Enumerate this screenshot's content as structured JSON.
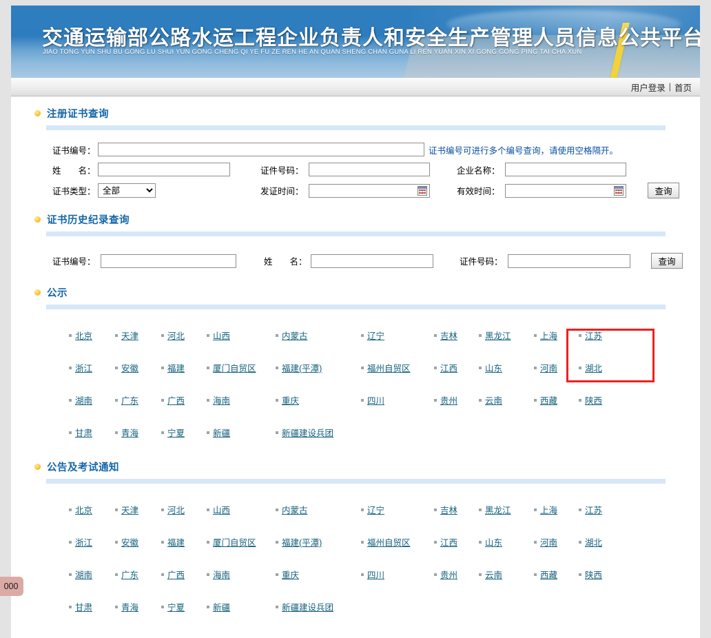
{
  "banner": {
    "title": "交通运输部公路水运工程企业负责人和安全生产管理人员信息公共平台查询",
    "subtitle": "JIAO TONG YUN SHU BU GONG LU SHUI YUN GONG CHENG QI YE FU ZE REN HE AN QUAN SHENG CHAN GUNA LI REN YUAN XIN XI GONG GONG PING TAI CHA XUN"
  },
  "topnav": {
    "login": "用户登录",
    "separator": "|",
    "home": "首页"
  },
  "cert_search": {
    "title": "注册证书查询",
    "labels": {
      "cert_no": "证书编号：",
      "name": "姓　　名：",
      "cert_type": "证书类型：",
      "id_no": "证件号码：",
      "issue_date": "发证时间：",
      "company": "企业名称：",
      "valid_date": "有效时间："
    },
    "values": {
      "cert_no": "",
      "name": "",
      "cert_type_selected": "全部",
      "id_no": "",
      "issue_date": "",
      "company": "",
      "valid_date": ""
    },
    "cert_type_options": [
      "全部"
    ],
    "hint": "证书编号可进行多个编号查询，请使用空格隔开。",
    "submit": "查询"
  },
  "history_search": {
    "title": "证书历史纪录查询",
    "labels": {
      "cert_no": "证书编号：",
      "name": "姓　　名：",
      "id_no": "证件号码："
    },
    "values": {
      "cert_no": "",
      "name": "",
      "id_no": ""
    },
    "submit": "查询"
  },
  "publicity": {
    "title": "公示",
    "rows": [
      [
        "北京",
        "天津",
        "河北",
        "山西",
        "内蒙古",
        "辽宁",
        "吉林",
        "黑龙江",
        "上海",
        "江苏"
      ],
      [
        "浙江",
        "安徽",
        "福建",
        "厦门自贸区",
        "福建(平潭)",
        "福州自贸区",
        "江西",
        "山东",
        "河南",
        "湖北"
      ],
      [
        "湖南",
        "广东",
        "广西",
        "海南",
        "重庆",
        "四川",
        "贵州",
        "云南",
        "西藏",
        "陕西"
      ],
      [
        "甘肃",
        "青海",
        "宁夏",
        "新疆",
        "新疆建设兵团"
      ]
    ]
  },
  "notices": {
    "title": "公告及考试通知",
    "rows": [
      [
        "北京",
        "天津",
        "河北",
        "山西",
        "内蒙古",
        "辽宁",
        "吉林",
        "黑龙江",
        "上海",
        "江苏"
      ],
      [
        "浙江",
        "安徽",
        "福建",
        "厦门自贸区",
        "福建(平潭)",
        "福州自贸区",
        "江西",
        "山东",
        "河南",
        "湖北"
      ],
      [
        "湖南",
        "广东",
        "广西",
        "海南",
        "重庆",
        "四川",
        "贵州",
        "云南",
        "西藏",
        "陕西"
      ],
      [
        "甘肃",
        "青海",
        "宁夏",
        "新疆",
        "新疆建设兵团"
      ]
    ]
  },
  "annotation": {
    "highlight_target": "湖北",
    "color": "#ef1f1f"
  },
  "corner_badge": {
    "text": "000"
  },
  "colors": {
    "banner_blue": "#2f7fc0",
    "section_title": "#1466a8",
    "rule": "#d6e7f7",
    "link": "#16627f",
    "bullet": "#fbc62f",
    "page_bg": "#e3e3e3"
  }
}
